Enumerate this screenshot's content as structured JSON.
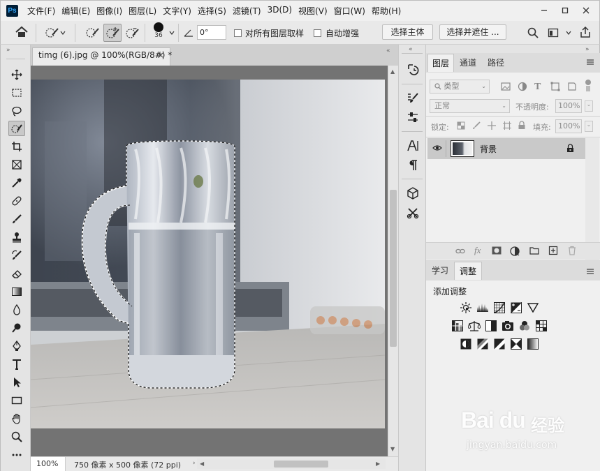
{
  "app": {
    "logo_text": "Ps"
  },
  "menu": {
    "items": [
      "文件(F)",
      "编辑(E)",
      "图像(I)",
      "图层(L)",
      "文字(Y)",
      "选择(S)",
      "滤镜(T)",
      "3D(D)",
      "视图(V)",
      "窗口(W)",
      "帮助(H)"
    ]
  },
  "options": {
    "brush_size": "36",
    "angle": "0°",
    "sample_all_layers": "对所有图层取样",
    "auto_enhance": "自动增强",
    "select_subject": "选择主体",
    "select_and_mask": "选择并遮住 ..."
  },
  "document": {
    "tab_title": "timg (6).jpg @ 100%(RGB/8#) *",
    "zoom": "100%",
    "info": "750 像素 x 500 像素 (72 ppi)"
  },
  "layers_panel": {
    "tabs": [
      "图层",
      "通道",
      "路径"
    ],
    "filter_kind": "类型",
    "blend_mode": "正常",
    "opacity_label": "不透明度:",
    "opacity_value": "100%",
    "lock_label": "锁定:",
    "fill_label": "填充:",
    "fill_value": "100%",
    "layers": [
      {
        "name": "背景",
        "visible": true,
        "locked": true
      }
    ]
  },
  "adjustments_panel": {
    "tabs": [
      "学习",
      "调整"
    ],
    "title": "添加调整"
  },
  "watermark": {
    "text_cn": "经验",
    "text_url": "jingyan.baidu.com",
    "brand": "Bai du"
  },
  "colors": {
    "accent_bg": "#e4e4e4",
    "canvas_gray": "#737373",
    "ps_blue": "#31a8ff"
  }
}
